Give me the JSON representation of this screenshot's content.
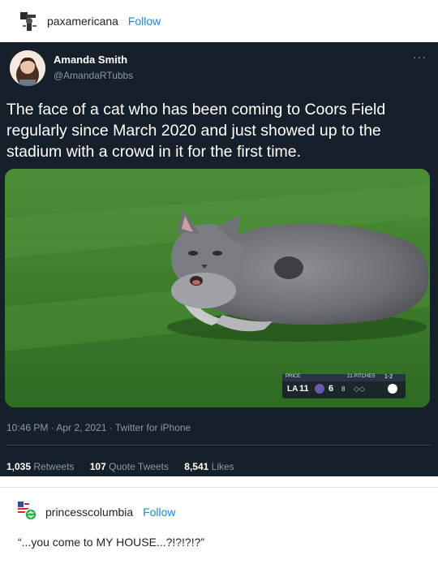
{
  "post": {
    "blog_name": "paxamericana",
    "follow_label": "Follow"
  },
  "tweet": {
    "name": "Amanda Smith",
    "handle": "@AmandaRTubbs",
    "more": "···",
    "text": "The face of a cat who has been coming to Coors Field regularly since March 2020 and just showed up to the stadium with a crowd in it for the first time.",
    "meta": "10:46 PM · Apr 2, 2021 · Twitter for iPhone",
    "stats": {
      "retweets_count": "1,035",
      "retweets_label": "Retweets",
      "quotes_count": "107",
      "quotes_label": "Quote Tweets",
      "likes_count": "8,541",
      "likes_label": "Likes"
    },
    "scorebug": {
      "label": "PRICE",
      "pitches": "21 PITCHES",
      "count": "1-2",
      "away_score": "11",
      "home_score": "6",
      "inning": "8"
    }
  },
  "reblog": {
    "blog_name": "princesscolumbia",
    "follow_label": "Follow",
    "text": "“...you come to MY HOUSE...?!?!?!?”"
  },
  "colors": {
    "tweet_bg": "#15202b",
    "follow": "#1a88d8",
    "grass": "#3f7d2e"
  }
}
